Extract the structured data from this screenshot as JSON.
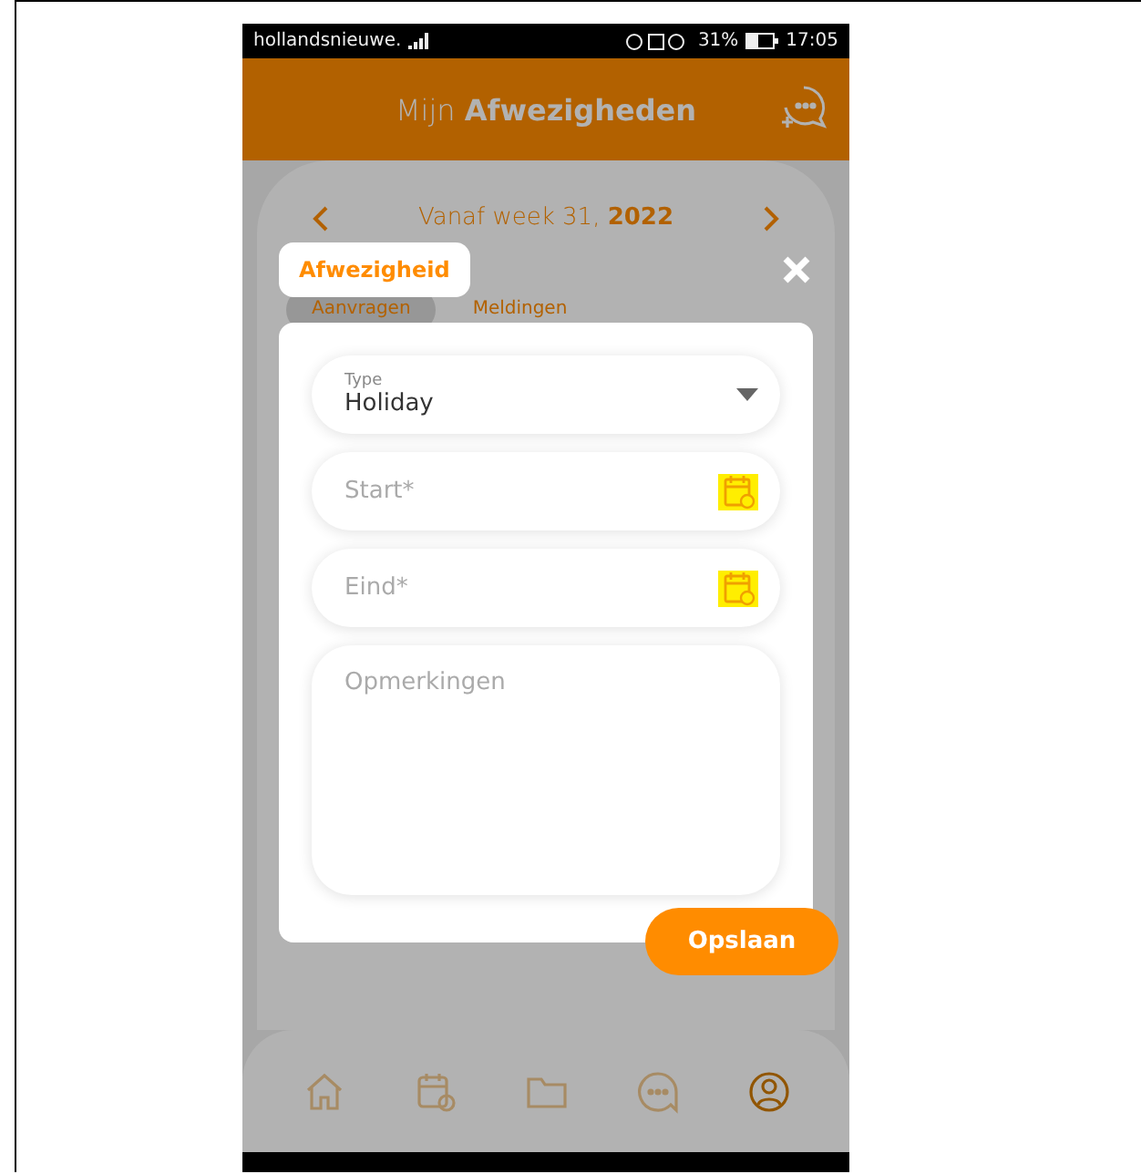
{
  "status_bar": {
    "carrier": "hollandsnieuwe.",
    "battery": "31%",
    "time": "17:05"
  },
  "header": {
    "title": "Mijn **Afwezigheden**"
  },
  "week_nav": {
    "label": "Vanaf week 31, **2022**"
  },
  "tabs": [
    {
      "label": "Aanvragen",
      "selected": true
    },
    {
      "label": "Meldingen",
      "selected": false
    }
  ],
  "dialog": {
    "title": "Afwezigheid",
    "fields": [
      {
        "kind": "select",
        "label": "Type",
        "value": "Holiday"
      },
      {
        "kind": "date",
        "placeholder": "Start*"
      },
      {
        "kind": "date",
        "placeholder": "Eind*"
      },
      {
        "kind": "textarea",
        "placeholder": "Opmerkingen"
      }
    ],
    "save_button": "Opslaan"
  },
  "bottom_nav": [
    {
      "kind": "home",
      "selected": false
    },
    {
      "kind": "calendar",
      "selected": false
    },
    {
      "kind": "folder",
      "selected": false
    },
    {
      "kind": "chat",
      "selected": false
    },
    {
      "kind": "profile",
      "selected": true
    }
  ]
}
